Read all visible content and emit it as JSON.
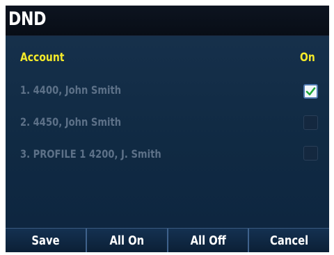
{
  "screen": {
    "title": "DND"
  },
  "list": {
    "header_account": "Account",
    "header_on": "On",
    "rows": [
      {
        "label": "1.  4400, John Smith",
        "checked": true
      },
      {
        "label": "2.  4450, John Smith",
        "checked": false
      },
      {
        "label": "3. PROFILE 1 4200, J. Smith",
        "checked": false
      }
    ]
  },
  "softkeys": [
    "Save",
    "All On",
    "All Off",
    "Cancel"
  ],
  "colors": {
    "header_text": "#f4ea2a",
    "row_text": "#5d7188",
    "check_mark": "#22a83a",
    "background": "#102a43"
  }
}
